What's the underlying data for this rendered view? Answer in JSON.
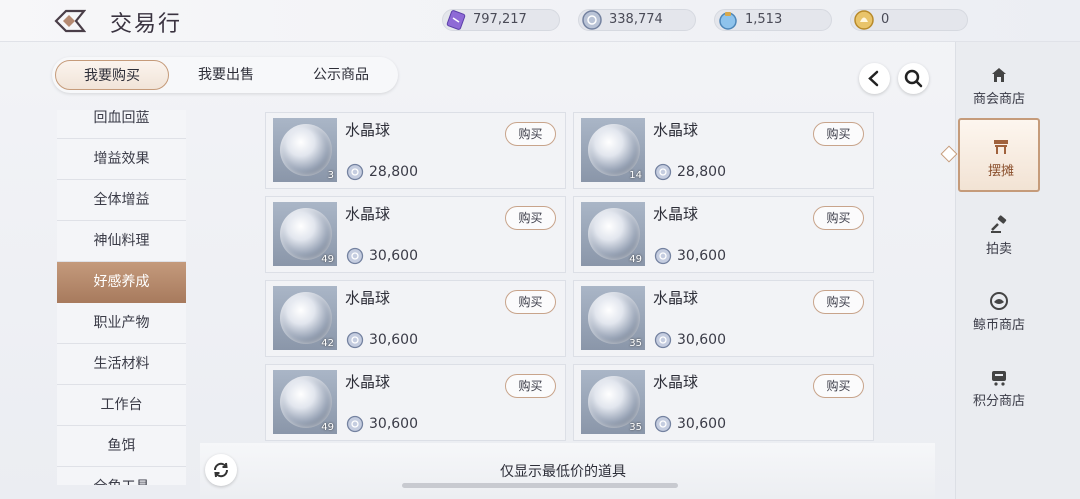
{
  "header": {
    "title": "交易行",
    "back_icon": "back-arrow-icon"
  },
  "currencies": [
    {
      "icon": "purple-ticket-icon",
      "value": "797,217"
    },
    {
      "icon": "silver-coin-icon",
      "value": "338,774"
    },
    {
      "icon": "bag-coin-icon",
      "value": "1,513"
    },
    {
      "icon": "gold-bell-icon",
      "value": "0"
    }
  ],
  "tabs": [
    {
      "label": "我要购买",
      "active": true
    },
    {
      "label": "我要出售",
      "active": false
    },
    {
      "label": "公示商品",
      "active": false
    }
  ],
  "toolbar": {
    "back_icon": "chevron-left-icon",
    "search_icon": "search-icon"
  },
  "categories": [
    {
      "label": "回血回蓝"
    },
    {
      "label": "增益效果"
    },
    {
      "label": "全体增益"
    },
    {
      "label": "神仙料理"
    },
    {
      "label": "好感养成",
      "active": true
    },
    {
      "label": "职业产物"
    },
    {
      "label": "生活材料"
    },
    {
      "label": "工作台"
    },
    {
      "label": "鱼饵"
    },
    {
      "label": "全角工具"
    }
  ],
  "items": [
    {
      "name": "水晶球",
      "qty": "3",
      "price": "28,800",
      "buy": "购买"
    },
    {
      "name": "水晶球",
      "qty": "14",
      "price": "28,800",
      "buy": "购买"
    },
    {
      "name": "水晶球",
      "qty": "49",
      "price": "30,600",
      "buy": "购买"
    },
    {
      "name": "水晶球",
      "qty": "49",
      "price": "30,600",
      "buy": "购买"
    },
    {
      "name": "水晶球",
      "qty": "42",
      "price": "30,600",
      "buy": "购买"
    },
    {
      "name": "水晶球",
      "qty": "35",
      "price": "30,600",
      "buy": "购买"
    },
    {
      "name": "水晶球",
      "qty": "49",
      "price": "30,600",
      "buy": "购买"
    },
    {
      "name": "水晶球",
      "qty": "35",
      "price": "30,600",
      "buy": "购买"
    }
  ],
  "bottom": {
    "refresh_icon": "refresh-icon",
    "lowest_label": "仅显示最低价的道具"
  },
  "shops": [
    {
      "label": "商会商店",
      "icon": "guild-shop-icon"
    },
    {
      "label": "摆摊",
      "icon": "stall-icon",
      "active": true
    },
    {
      "label": "拍卖",
      "icon": "auction-hammer-icon"
    },
    {
      "label": "鲸币商店",
      "icon": "whale-coin-icon"
    },
    {
      "label": "积分商店",
      "icon": "points-shop-icon"
    }
  ],
  "colors": {
    "accent": "#c59b7a",
    "active_category": "#b2876a",
    "background": "#eef0f4"
  }
}
